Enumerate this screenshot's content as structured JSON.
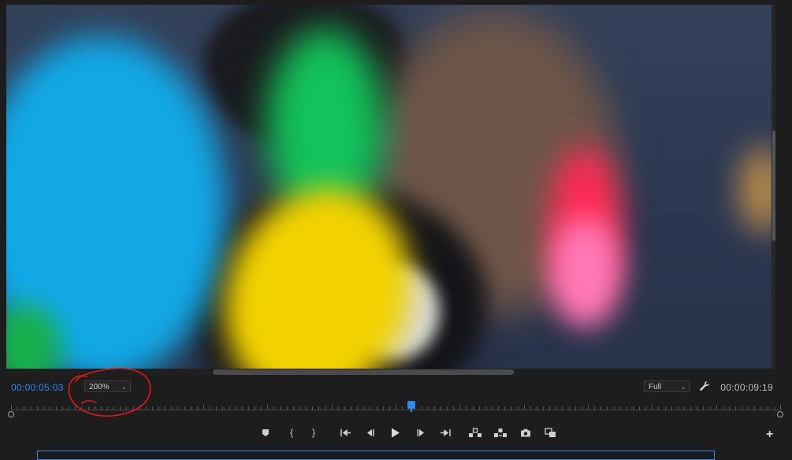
{
  "program_monitor": {
    "current_timecode": "00:00:05:03",
    "duration_timecode": "00:00:09:19",
    "zoom_level": {
      "selected": "200%"
    },
    "playback_resolution": {
      "selected": "Full"
    },
    "playhead_position": 0.52
  },
  "transport_controls": [
    {
      "name": "add-marker-button",
      "icon": "marker-icon"
    },
    {
      "name": "mark-in-button",
      "icon": "mark-in-icon",
      "glyph": "{"
    },
    {
      "name": "mark-out-button",
      "icon": "mark-out-icon",
      "glyph": "}"
    },
    {
      "name": "go-to-in-button",
      "icon": "go-to-in-icon"
    },
    {
      "name": "step-back-button",
      "icon": "step-back-icon"
    },
    {
      "name": "play-button",
      "icon": "play-icon"
    },
    {
      "name": "step-forward-button",
      "icon": "step-forward-icon"
    },
    {
      "name": "go-to-out-button",
      "icon": "go-to-out-icon"
    },
    {
      "name": "lift-button",
      "icon": "lift-icon"
    },
    {
      "name": "extract-button",
      "icon": "extract-icon"
    },
    {
      "name": "export-frame-button",
      "icon": "camera-icon"
    },
    {
      "name": "comparison-view-button",
      "icon": "comparison-icon"
    }
  ],
  "colors": {
    "accent": "#2d8ceb",
    "annotation": "#e01818",
    "panel_bg": "#1d1d1d"
  }
}
